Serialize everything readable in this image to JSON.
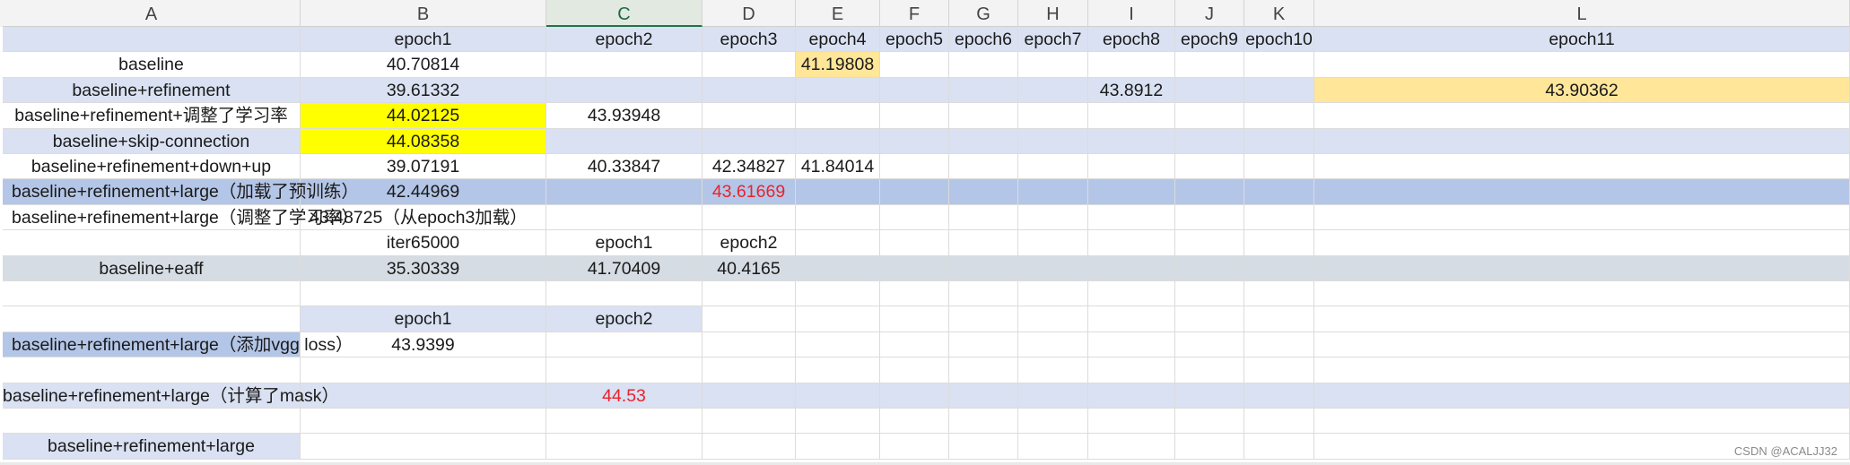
{
  "columns": [
    "A",
    "B",
    "C",
    "D",
    "E",
    "F",
    "G",
    "H",
    "I",
    "J",
    "K",
    "L"
  ],
  "selected_column": "C",
  "rows": [
    [
      "",
      "epoch1",
      "epoch2",
      "epoch3",
      "epoch4",
      "epoch5",
      "epoch6",
      "epoch7",
      "epoch8",
      "epoch9",
      "epoch10",
      "epoch11"
    ],
    [
      "baseline",
      "40.70814",
      "",
      "",
      "41.19808",
      "",
      "",
      "",
      "",
      "",
      "",
      ""
    ],
    [
      "baseline+refinement",
      "39.61332",
      "",
      "",
      "",
      "",
      "",
      "",
      "43.8912",
      "",
      "",
      "43.90362"
    ],
    [
      "baseline+refinement+调整了学习率",
      "44.02125",
      "43.93948",
      "",
      "",
      "",
      "",
      "",
      "",
      "",
      "",
      ""
    ],
    [
      "baseline+skip-connection",
      "44.08358",
      "",
      "",
      "",
      "",
      "",
      "",
      "",
      "",
      "",
      ""
    ],
    [
      "baseline+refinement+down+up",
      "39.07191",
      "40.33847",
      "42.34827",
      "41.84014",
      "",
      "",
      "",
      "",
      "",
      "",
      ""
    ],
    [
      "baseline+refinement+large（加载了预训练）",
      "42.44969",
      "",
      "43.61669",
      "",
      "",
      "",
      "",
      "",
      "",
      "",
      ""
    ],
    [
      "baseline+refinement+large（调整了学习率）",
      "43.48725（从epoch3加载）",
      "",
      "",
      "",
      "",
      "",
      "",
      "",
      "",
      "",
      ""
    ],
    [
      "",
      "iter65000",
      "epoch1",
      "epoch2",
      "",
      "",
      "",
      "",
      "",
      "",
      "",
      ""
    ],
    [
      "baseline+eaff",
      "35.30339",
      "41.70409",
      "40.4165",
      "",
      "",
      "",
      "",
      "",
      "",
      "",
      ""
    ],
    [
      "",
      "",
      "",
      "",
      "",
      "",
      "",
      "",
      "",
      "",
      "",
      ""
    ],
    [
      "",
      "epoch1",
      "epoch2",
      "",
      "",
      "",
      "",
      "",
      "",
      "",
      "",
      ""
    ],
    [
      "baseline+refinement+large（添加vgg loss）",
      "43.9399",
      "",
      "",
      "",
      "",
      "",
      "",
      "",
      "",
      "",
      ""
    ],
    [
      "",
      "",
      "",
      "",
      "",
      "",
      "",
      "",
      "",
      "",
      "",
      ""
    ],
    [
      "baseline+refinement+large（计算了mask）",
      "",
      "44.53",
      "",
      "",
      "",
      "",
      "",
      "",
      "",
      "",
      ""
    ],
    [
      "",
      "",
      "",
      "",
      "",
      "",
      "",
      "",
      "",
      "",
      "",
      ""
    ],
    [
      "baseline+refinement+large",
      "",
      "",
      "",
      "",
      "",
      "",
      "",
      "",
      "",
      "",
      ""
    ]
  ],
  "colors": {
    "band_blue": "#d9e1f2",
    "band_dark": "#b4c6e7",
    "band_gray": "#d6dce4",
    "highlight_yellow": "#ffff00",
    "highlight_peach": "#ffe699",
    "text_red": "#e8232e"
  },
  "watermark": "CSDN @ACALJJ32"
}
